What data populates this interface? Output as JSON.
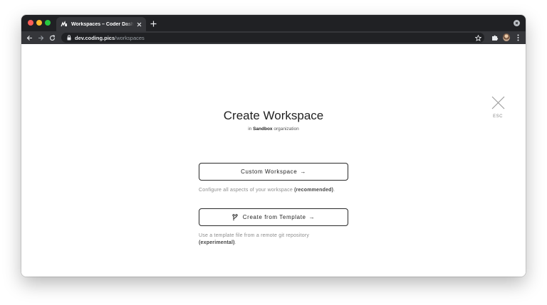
{
  "browser": {
    "tab_title": "Workspaces – Coder Dashboard",
    "url_host": "dev.coding.pics",
    "url_path": "/workspaces"
  },
  "page": {
    "title": "Create Workspace",
    "subtitle_prefix": "in",
    "subtitle_org": "Sandbox",
    "subtitle_suffix": "organization",
    "esc_label": "ESC"
  },
  "options": {
    "custom": {
      "label": "Custom Workspace",
      "arrow": "→",
      "description": "Configure all aspects of your workspace",
      "description_emphasis": "(recommended)",
      "description_end": "."
    },
    "template": {
      "label": "Create from Template",
      "arrow": "→",
      "description": "Use a template file from a remote git repository",
      "description_emphasis": "(experimental)",
      "description_end": "."
    }
  },
  "colors": {
    "chrome_dark": "#202124",
    "chrome_tab": "#35363a",
    "button_border": "#2a2a2a",
    "muted_text": "#8c8c8c"
  }
}
